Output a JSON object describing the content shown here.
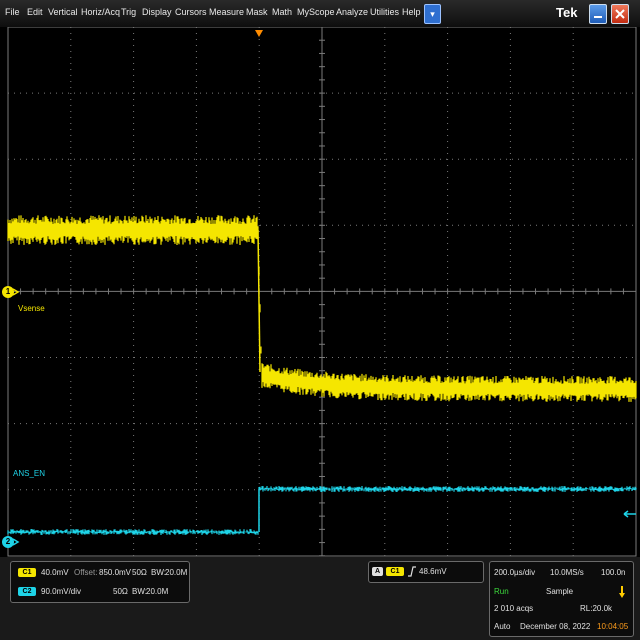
{
  "menu": {
    "items": [
      "File",
      "Edit",
      "Vertical",
      "Horiz/Acq",
      "Trig",
      "Display",
      "Cursors",
      "Measure",
      "Mask",
      "Math",
      "MyScope",
      "Analyze",
      "Utilities",
      "Help"
    ],
    "dropdown": "▾",
    "logo": "Tek"
  },
  "colors": {
    "ch1": "#f5e600",
    "ch2": "#1ed4e8",
    "grid": "#7a7a7a",
    "trigger": "#ff8c00"
  },
  "waveforms": {
    "ch1": {
      "marker": "1",
      "label": "Vsense"
    },
    "ch2": {
      "marker": "2",
      "label": "ANS_EN"
    }
  },
  "channels": {
    "ch1": {
      "badge": "C1",
      "scale": "40.0mV",
      "offset_label": "Offset:",
      "offset": "850.0mV",
      "impedance": "50Ω",
      "bw_label": "BW:",
      "bw": "20.0M"
    },
    "ch2": {
      "badge": "C2",
      "scale": "90.0mV/div",
      "impedance": "50Ω",
      "bw_label": "BW:",
      "bw": "20.0M"
    }
  },
  "trigger": {
    "mode_badge": "A",
    "source": "C1",
    "slope_icon": "rising-edge-icon",
    "level": "48.6mV"
  },
  "timebase": {
    "per_div": "200.0µs/div",
    "sample_rate": "10.0MS/s",
    "resolution": "100.0n"
  },
  "acquisition": {
    "state": "Run",
    "mode": "Sample",
    "acqs": "2 010 acqs",
    "record_length": "RL:20.0k",
    "trigger_mode": "Auto",
    "date": "December 08, 2022",
    "time": "10:04:05"
  }
}
